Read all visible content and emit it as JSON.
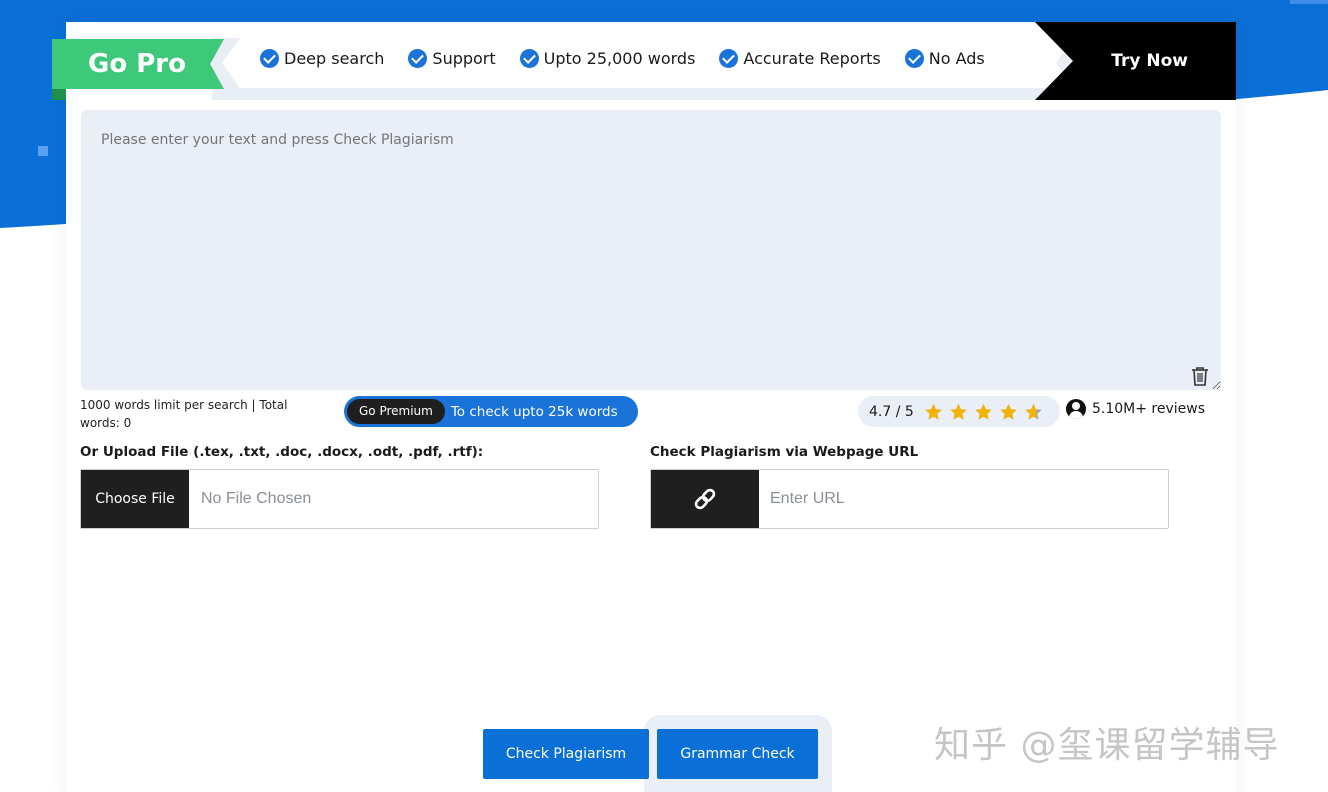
{
  "banner": {
    "go_pro_label": "Go Pro",
    "features": [
      "Deep search",
      "Support",
      "Upto 25,000 words",
      "Accurate Reports",
      "No Ads"
    ],
    "try_now_label": "Try Now"
  },
  "editor": {
    "placeholder": "Please enter your text and press Check Plagiarism",
    "limit_text": "1000 words limit per search | Total words: 0"
  },
  "premium": {
    "pill_label": "Go Premium",
    "text": "To check upto 25k words"
  },
  "rating": {
    "score_text": "4.7 / 5",
    "stars_value": 4.7,
    "stars_max": 5,
    "reviews_text": "5.10M+ reviews"
  },
  "upload": {
    "label": "Or Upload File (.tex, .txt, .doc, .docx, .odt, .pdf, .rtf):",
    "button_label": "Choose File",
    "status_text": "No File Chosen"
  },
  "url_check": {
    "label": "Check Plagiarism via Webpage URL",
    "placeholder": "Enter URL",
    "icon": "link-icon"
  },
  "actions": {
    "check_label": "Check Plagiarism",
    "grammar_label": "Grammar Check"
  },
  "watermark": "知乎 @玺课留学辅导",
  "colors": {
    "primary_blue": "#1a73d9",
    "go_pro_green": "#3ec97a",
    "star_yellow": "#f5b300",
    "dark": "#1f1f1f"
  }
}
